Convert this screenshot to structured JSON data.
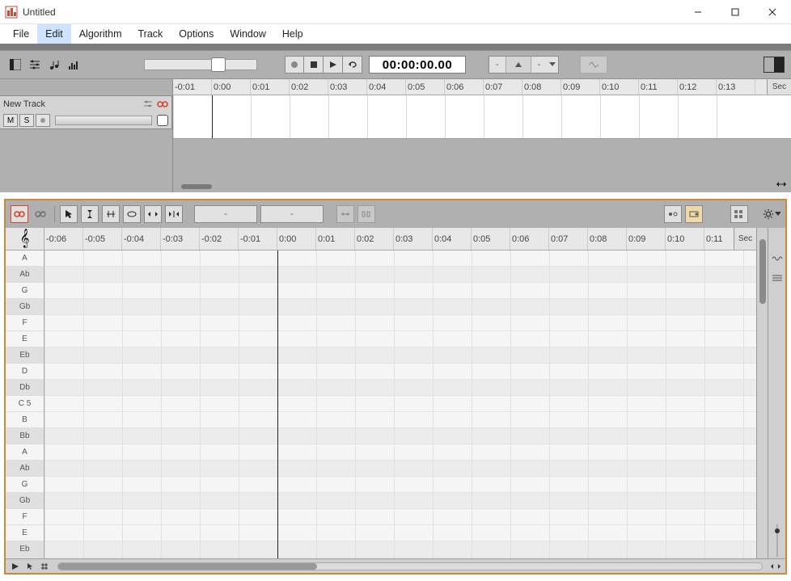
{
  "window": {
    "title": "Untitled"
  },
  "menu": {
    "items": [
      "File",
      "Edit",
      "Algorithm",
      "Track",
      "Options",
      "Window",
      "Help"
    ],
    "active": "Edit"
  },
  "toolbar": {
    "time_display": "00:00:00.00",
    "range_left": "-",
    "range_right": "-",
    "slider_pos_pct": 68
  },
  "timeline": {
    "ticks": [
      "-0:01",
      "0:00",
      "0:01",
      "0:02",
      "0:03",
      "0:04",
      "0:05",
      "0:06",
      "0:07",
      "0:08",
      "0:09",
      "0:10",
      "0:11",
      "0:12",
      "0:13"
    ],
    "unit": "Sec",
    "playhead_index": 1
  },
  "track": {
    "name": "New Track",
    "mute_label": "M",
    "solo_label": "S"
  },
  "lower": {
    "stat1": "-",
    "stat2": "-",
    "clef": "𝄞",
    "ticks": [
      "-0:06",
      "-0:05",
      "-0:04",
      "-0:03",
      "-0:02",
      "-0:01",
      "0:00",
      "0:01",
      "0:02",
      "0:03",
      "0:04",
      "0:05",
      "0:06",
      "0:07",
      "0:08",
      "0:09",
      "0:10",
      "0:11"
    ],
    "unit": "Sec",
    "zero_index": 6,
    "keys": [
      "A",
      "Ab",
      "G",
      "Gb",
      "F",
      "E",
      "Eb",
      "D",
      "Db",
      "C 5",
      "B",
      "Bb",
      "A",
      "Ab",
      "G",
      "Gb",
      "F",
      "E",
      "Eb"
    ],
    "black_keys": [
      "Ab",
      "Gb",
      "Eb",
      "Db",
      "Bb"
    ]
  }
}
